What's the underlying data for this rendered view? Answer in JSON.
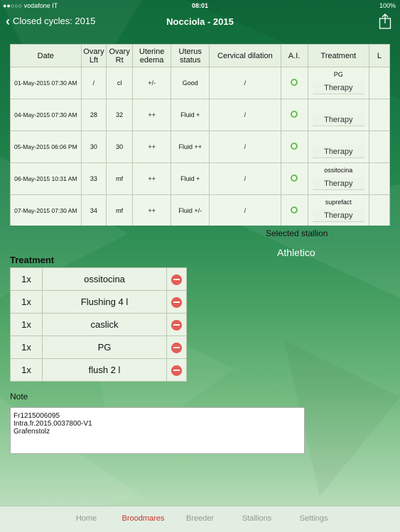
{
  "status_bar": {
    "carrier": "●●○○○ vodafone IT",
    "time": "08:01",
    "battery": "100%"
  },
  "nav": {
    "back_label": "Closed cycles: 2015",
    "title": "Nocciola - 2015"
  },
  "table": {
    "headers": [
      "Date",
      "Ovary Lft",
      "Ovary Rt",
      "Uterine edema",
      "Uterus status",
      "Cervical dilation",
      "A.I.",
      "Treatment",
      "L"
    ],
    "rows": [
      {
        "date": "01-May-2015 07:30 AM",
        "ovary_lft": "/",
        "ovary_rt": "cl",
        "uterine_edema": "+/-",
        "uterus_status": "Good",
        "cervical_dilation": "/",
        "treatment_name": "PG",
        "treatment_button": "Therapy"
      },
      {
        "date": "04-May-2015 07:30 AM",
        "ovary_lft": "28",
        "ovary_rt": "32",
        "uterine_edema": "++",
        "uterus_status": "Fluid +",
        "cervical_dilation": "/",
        "treatment_name": "",
        "treatment_button": "Therapy"
      },
      {
        "date": "05-May-2015 06:06 PM",
        "ovary_lft": "30",
        "ovary_rt": "30",
        "uterine_edema": "++",
        "uterus_status": "Fluid ++",
        "cervical_dilation": "/",
        "treatment_name": "",
        "treatment_button": "Therapy"
      },
      {
        "date": "06-May-2015 10:31 AM",
        "ovary_lft": "33",
        "ovary_rt": "mf",
        "uterine_edema": "++",
        "uterus_status": "Fluid +",
        "cervical_dilation": "/",
        "treatment_name": "ossitocina",
        "treatment_button": "Therapy"
      },
      {
        "date": "07-May-2015 07:30 AM",
        "ovary_lft": "34",
        "ovary_rt": "mf",
        "uterine_edema": "++",
        "uterus_status": "Fluid +/-",
        "cervical_dilation": "/",
        "treatment_name": "suprefact",
        "treatment_button": "Therapy"
      }
    ]
  },
  "stallion": {
    "label": "Selected stallion",
    "value": "Athletico"
  },
  "treatment": {
    "title": "Treatment",
    "items": [
      {
        "qty": "1x",
        "name": "ossitocina"
      },
      {
        "qty": "1x",
        "name": "Flushing 4 l"
      },
      {
        "qty": "1x",
        "name": "caslick"
      },
      {
        "qty": "1x",
        "name": "PG"
      },
      {
        "qty": "1x",
        "name": "flush 2 l"
      }
    ]
  },
  "note": {
    "label": "Note",
    "text": "Fr1215006095\nIntra.fr.2015.0037800-V1\nGrafenstolz"
  },
  "tabs": [
    "Home",
    "Broodmares",
    "Breeder",
    "Stallions",
    "Settings"
  ],
  "active_tab": "Broodmares",
  "icons": {
    "back": "chevron-left-icon",
    "share": "share-icon",
    "remove": "minus-circle-icon",
    "ai": "circle-icon"
  },
  "colors": {
    "accent_active": "#c8342c",
    "remove": "#e35d55",
    "ai_ring": "#6cbd52"
  }
}
